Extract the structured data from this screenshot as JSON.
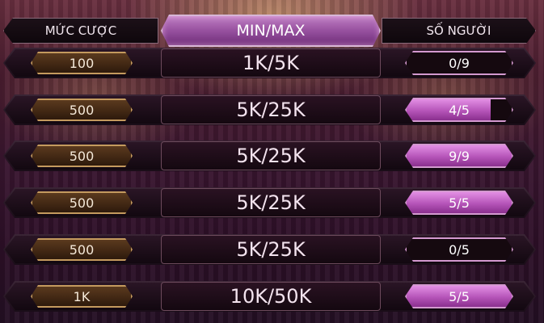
{
  "header": {
    "bet_label": "MỨC CƯỢC",
    "minmax_label": "MIN/MAX",
    "players_label": "SỐ NGƯỜI"
  },
  "rows": [
    {
      "bet": "100",
      "minmax": "1K/5K",
      "players": "0/9",
      "fill_fraction": 0
    },
    {
      "bet": "500",
      "minmax": "5K/25K",
      "players": "4/5",
      "fill_fraction": 0.8
    },
    {
      "bet": "500",
      "minmax": "5K/25K",
      "players": "9/9",
      "fill_fraction": 1
    },
    {
      "bet": "500",
      "minmax": "5K/25K",
      "players": "5/5",
      "fill_fraction": 1
    },
    {
      "bet": "500",
      "minmax": "5K/25K",
      "players": "0/5",
      "fill_fraction": 0
    },
    {
      "bet": "1K",
      "minmax": "10K/50K",
      "players": "5/5",
      "fill_fraction": 1
    }
  ],
  "colors": {
    "accent_pink": "#d46fd4",
    "gold_border": "#c49a5e",
    "header_purple": "#9b55a3"
  }
}
